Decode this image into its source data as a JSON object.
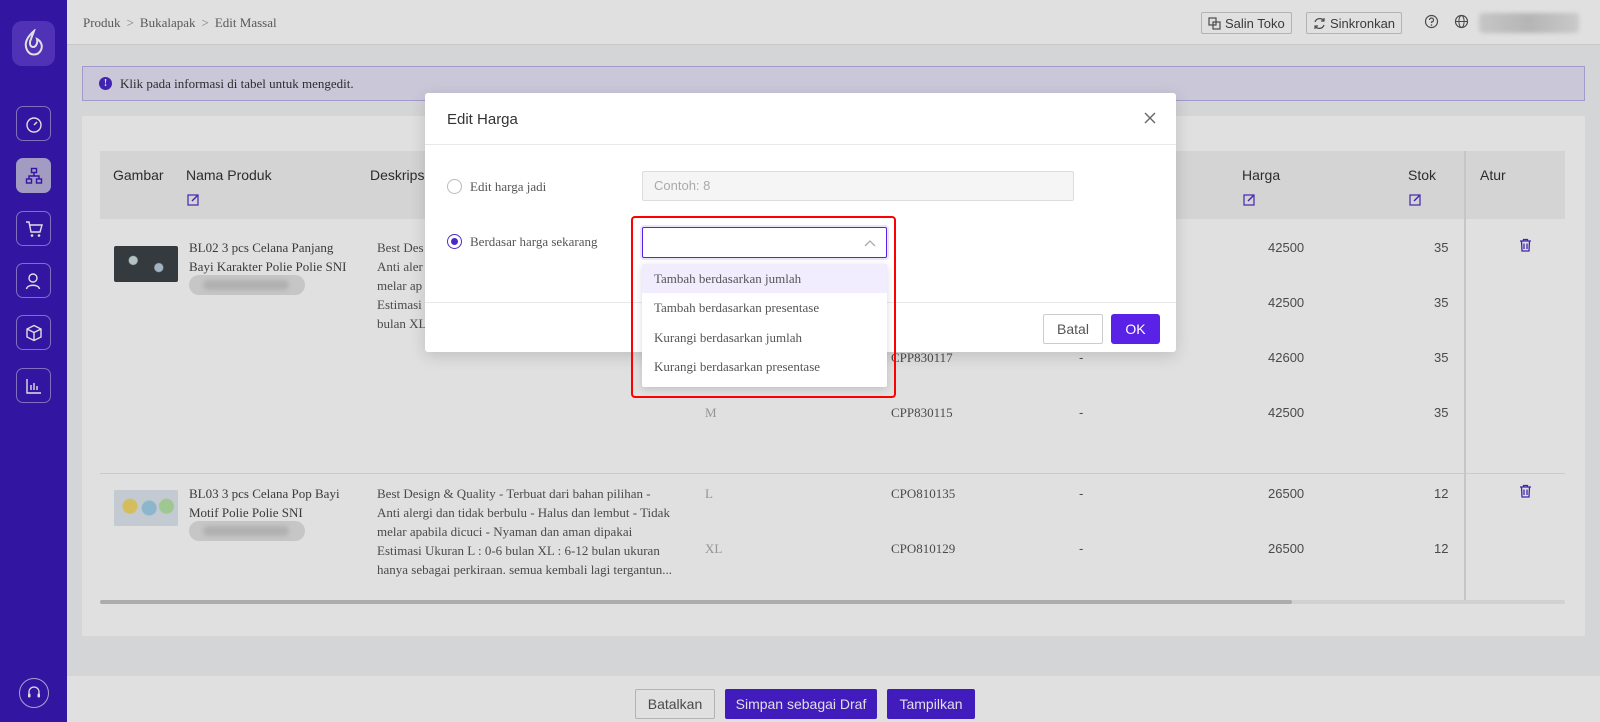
{
  "breadcrumb": [
    "Produk",
    "Bukalapak",
    "Edit Massal"
  ],
  "topbar": {
    "copy_store": "Salin Toko",
    "sync": "Sinkronkan"
  },
  "banner": {
    "text": "Klik pada informasi di tabel untuk mengedit."
  },
  "table": {
    "headers": {
      "image": "Gambar",
      "name": "Nama Produk",
      "description": "Deskripsi",
      "price": "Harga",
      "stock": "Stok",
      "actions": "Atur"
    },
    "product1": {
      "name_line1": "BL02 3 pcs Celana Panjang",
      "name_line2": "Bayi Karakter Polie Polie SNI",
      "desc_lines": [
        "Best Des",
        "Anti aler",
        "melar ap",
        "Estimasi",
        "bulan XL"
      ],
      "variants": [
        {
          "size": "",
          "sku": "",
          "dash": "",
          "price": "42500",
          "stock": "35"
        },
        {
          "size": "",
          "sku": "",
          "dash": "",
          "price": "42500",
          "stock": "35"
        },
        {
          "size": "",
          "sku": "CPP830117",
          "dash": "-",
          "price": "42600",
          "stock": "35"
        },
        {
          "size": "M",
          "sku": "CPP830115",
          "dash": "-",
          "price": "42500",
          "stock": "35"
        }
      ]
    },
    "product2": {
      "name_line1": "BL03 3 pcs Celana Pop Bayi",
      "name_line2": "Motif Polie Polie SNI",
      "desc_lines": [
        "Best Design & Quality - Terbuat dari bahan pilihan -",
        "Anti alergi dan tidak berbulu - Halus dan lembut - Tidak",
        "melar apabila dicuci - Nyaman dan aman dipakai",
        "Estimasi Ukuran L : 0-6 bulan XL : 6-12 bulan ukuran",
        "hanya sebagai perkiraan. semua kembali lagi tergantun..."
      ],
      "variants": [
        {
          "size": "L",
          "sku": "CPO810135",
          "dash": "-",
          "price": "26500",
          "stock": "12"
        },
        {
          "size": "XL",
          "sku": "CPO810129",
          "dash": "-",
          "price": "26500",
          "stock": "12"
        }
      ]
    }
  },
  "footer": {
    "cancel": "Batalkan",
    "save_draft": "Simpan sebagai Draf",
    "publish": "Tampilkan"
  },
  "modal": {
    "title": "Edit Harga",
    "option_fixed": "Edit harga jadi",
    "fixed_placeholder": "Contoh: 8",
    "option_current": "Berdasar harga sekarang",
    "cancel": "Batal",
    "ok": "OK",
    "dropdown_options": [
      "Tambah berdasarkan jumlah",
      "Tambah berdasarkan presentase",
      "Kurangi berdasarkan jumlah",
      "Kurangi berdasarkan presentase"
    ]
  },
  "colors": {
    "sidebar": "#3a18b8",
    "primary": "#5a22e6",
    "highlight": "#ff0000"
  }
}
